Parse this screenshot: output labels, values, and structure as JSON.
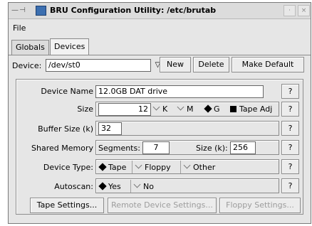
{
  "window": {
    "title": "BRU Configuration Utility: /etc/brutab",
    "menu_glyph": "— ⊣",
    "minimize_glyph": "·",
    "close_glyph": "×"
  },
  "menubar": {
    "file": "File"
  },
  "tabs": [
    {
      "label": "Globals",
      "active": false
    },
    {
      "label": "Devices",
      "active": true
    }
  ],
  "device": {
    "label": "Device:",
    "value": "/dev/st0",
    "dropdown_glyph": "▽"
  },
  "buttons": {
    "new": "New",
    "delete": "Delete",
    "make_default": "Make Default"
  },
  "form": {
    "device_name": {
      "label": "Device Name",
      "value": "12.0GB DAT drive"
    },
    "size": {
      "label": "Size",
      "value": "12",
      "units": [
        {
          "label": "K",
          "selected": false
        },
        {
          "label": "M",
          "selected": false
        },
        {
          "label": "G",
          "selected": true
        }
      ],
      "tape_adj": {
        "label": "Tape Adj",
        "checked": true
      }
    },
    "buffer_size": {
      "label": "Buffer Size (k)",
      "value": "32"
    },
    "shared_memory": {
      "label": "Shared Memory",
      "segments_label": "Segments:",
      "segments_value": "7",
      "size_label": "Size (k):",
      "size_value": "256"
    },
    "device_type": {
      "label": "Device Type:",
      "options": [
        {
          "label": "Tape",
          "selected": true
        },
        {
          "label": "Floppy",
          "selected": false
        },
        {
          "label": "Other",
          "selected": false
        }
      ]
    },
    "autoscan": {
      "label": "Autoscan:",
      "options": [
        {
          "label": "Yes",
          "selected": true
        },
        {
          "label": "No",
          "selected": false
        }
      ]
    },
    "help": "?"
  },
  "bottom_buttons": {
    "tape_settings": "Tape Settings...",
    "remote_settings": "Remote Device Settings...",
    "floppy_settings": "Floppy Settings..."
  },
  "colors": {
    "window_bg": "#e6e6e6",
    "field_bg": "#ffffff",
    "disabled_text": "#9c9c9c"
  }
}
